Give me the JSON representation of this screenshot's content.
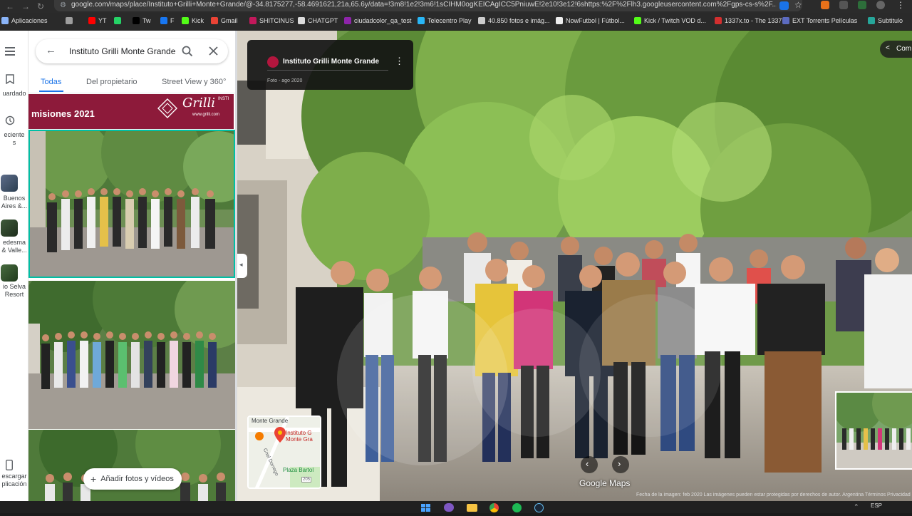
{
  "browser": {
    "url": "google.com/maps/place/Instituto+Grilli+Monte+Grande/@-34.8175277,-58.4691621,21a,65.6y/data=!3m8!1e2!3m6!1sCIHM0ogKEICAgICC5PniuwE!2e10!3e12!6shttps:%2F%2Flh3.googleusercontent.com%2Fgps-cs-s%2F...",
    "bookmarks": [
      {
        "label": "Aplicaciones",
        "icon": "apps-icon",
        "color": "#8ab4f8"
      },
      {
        "label": "",
        "icon": "grid-icon",
        "color": "#9e9e9e"
      },
      {
        "label": "YT",
        "icon": "youtube-icon",
        "color": "#ff0000"
      },
      {
        "label": "",
        "icon": "whatsapp-icon",
        "color": "#25d366"
      },
      {
        "label": "Tw",
        "icon": "x-twitter-icon",
        "color": "#000000"
      },
      {
        "label": "F",
        "icon": "facebook-icon",
        "color": "#1877f2"
      },
      {
        "label": "Kick",
        "icon": "kick-icon",
        "color": "#53fc18"
      },
      {
        "label": "Gmail",
        "icon": "gmail-icon",
        "color": "#ea4335"
      },
      {
        "label": "SHITCINUS",
        "icon": "folder-icon",
        "color": "#c2185b"
      },
      {
        "label": "CHATGPT",
        "icon": "chatgpt-icon",
        "color": "#dddddd"
      },
      {
        "label": "ciudadcolor_qa_test",
        "icon": "globe-icon",
        "color": "#8e24aa"
      },
      {
        "label": "Telecentro Play",
        "icon": "play-icon",
        "color": "#29b6f6"
      },
      {
        "label": "40.850 fotos e imág...",
        "icon": "image-site-icon",
        "color": "#cccccc"
      },
      {
        "label": "NowFutbol | Fútbol...",
        "icon": "ball-icon",
        "color": "#eeeeee"
      },
      {
        "label": "Kick / Twitch VOD d...",
        "icon": "kick-d-icon",
        "color": "#53fc18"
      },
      {
        "label": "1337x.to - The 1337...",
        "icon": "x-site-icon",
        "color": "#d32f2f"
      },
      {
        "label": "EXT Torrents Películas",
        "icon": "ext-icon",
        "color": "#5c6bc0"
      },
      {
        "label": "Subtitulo",
        "icon": "subtitle-icon",
        "color": "#26a69a"
      }
    ]
  },
  "rail": {
    "saved_label": "uardado",
    "recent_label": "eciente\ns",
    "places": [
      {
        "label": "Buenos\nAires &..."
      },
      {
        "label": "edesma\n& Valle..."
      },
      {
        "label": "io Selva\nResort"
      }
    ],
    "bottom_label": "escargar\nplicación"
  },
  "panel": {
    "search_value": "Instituto Grilli Monte Grande",
    "tabs": [
      "Todas",
      "Del propietario",
      "Street View y 360°"
    ],
    "banner_text": "misiones 2021",
    "banner_brand": "Grilli",
    "banner_brand_small": "INSTI",
    "banner_url": "www.grilli.com",
    "add_photos_label": "Añadir fotos y vídeos"
  },
  "viewer": {
    "place_title": "Instituto Grilli Monte Grande",
    "photo_meta": "Foto - ago 2020",
    "share_label": "Com",
    "minimap": {
      "area": "Monte Grande",
      "pin_label": "Instituto G Monte Gra",
      "street": "Cnel Dorrego",
      "plaza": "Plaza Bartol",
      "road_number": "205"
    },
    "watermark": "Google Maps",
    "footer": "Fecha de la imagen: feb 2020    Las imágenes pueden estar protegidas por derechos de autor.    Argentina    Términos    Privacidad"
  },
  "taskbar": {
    "lang": "ESP"
  },
  "colors": {
    "accent": "#1a73e8",
    "banner": "#8d1a3a",
    "photo_border": "#00bfa5"
  }
}
